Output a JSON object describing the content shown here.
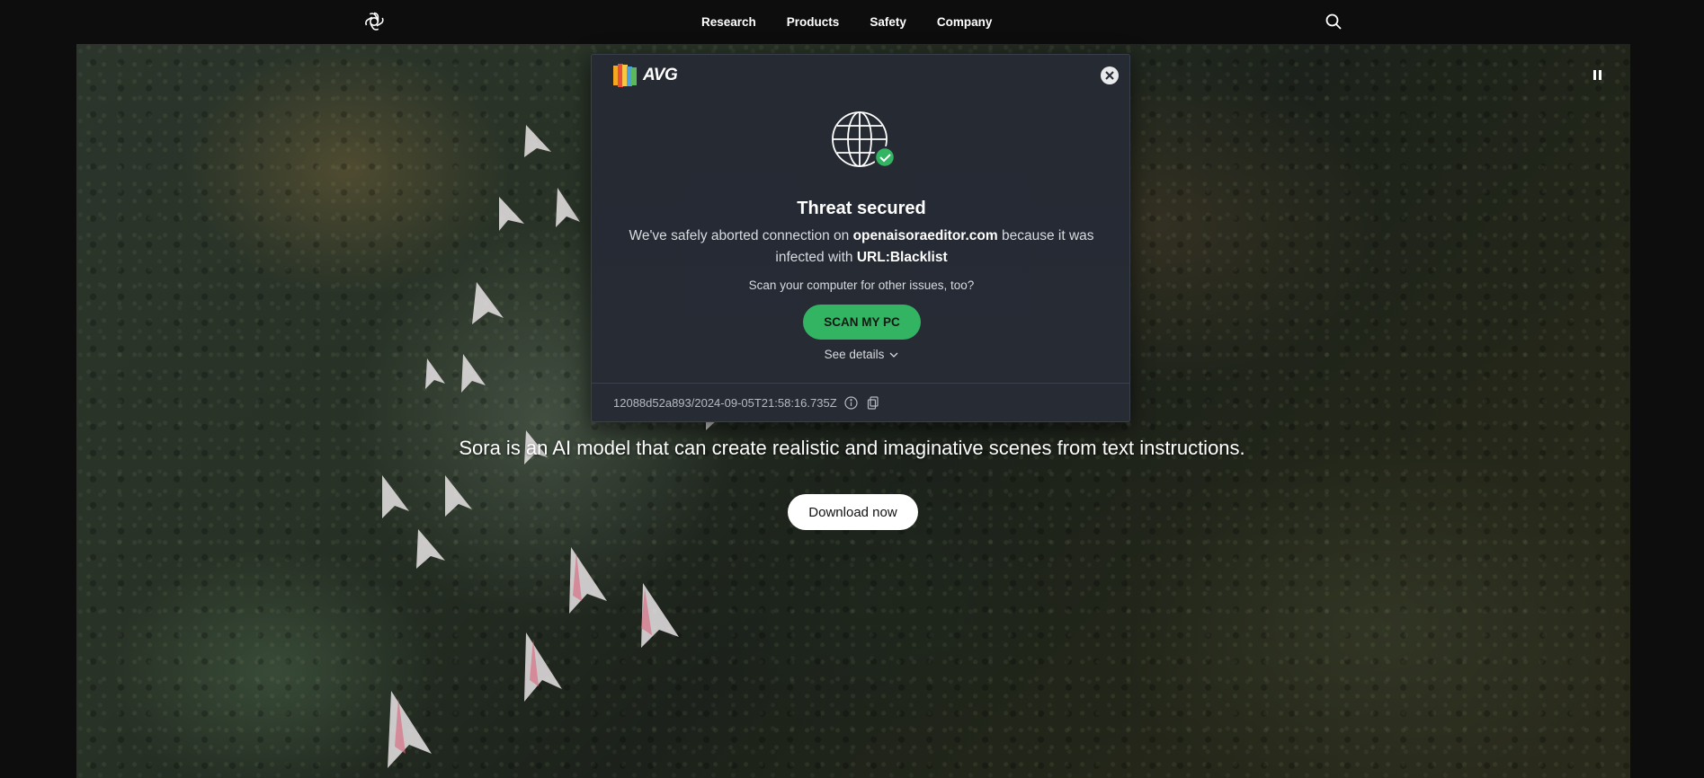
{
  "nav": {
    "links": [
      "Research",
      "Products",
      "Safety",
      "Company"
    ],
    "logo_icon": "openai-logo-icon",
    "search_icon": "search-icon"
  },
  "hero": {
    "tagline": "Sora is an AI model that can create realistic and imaginative scenes from text instructions.",
    "download_label": "Download now",
    "pause_icon": "pause-icon"
  },
  "avg_popup": {
    "brand": "AVG",
    "title": "Threat secured",
    "message_prefix": "We've safely aborted connection on ",
    "domain": "openaisoraeditor.com",
    "message_middle": " because it was infected with ",
    "threat": "URL:Blacklist",
    "sub": "Scan your computer for other issues, too?",
    "scan_label": "SCAN MY PC",
    "details_label": "See details",
    "footer_id": "12088d52a893/2024-09-05T21:58:16.735Z",
    "colors": {
      "accent": "#33b463",
      "panel": "#262b34"
    }
  }
}
